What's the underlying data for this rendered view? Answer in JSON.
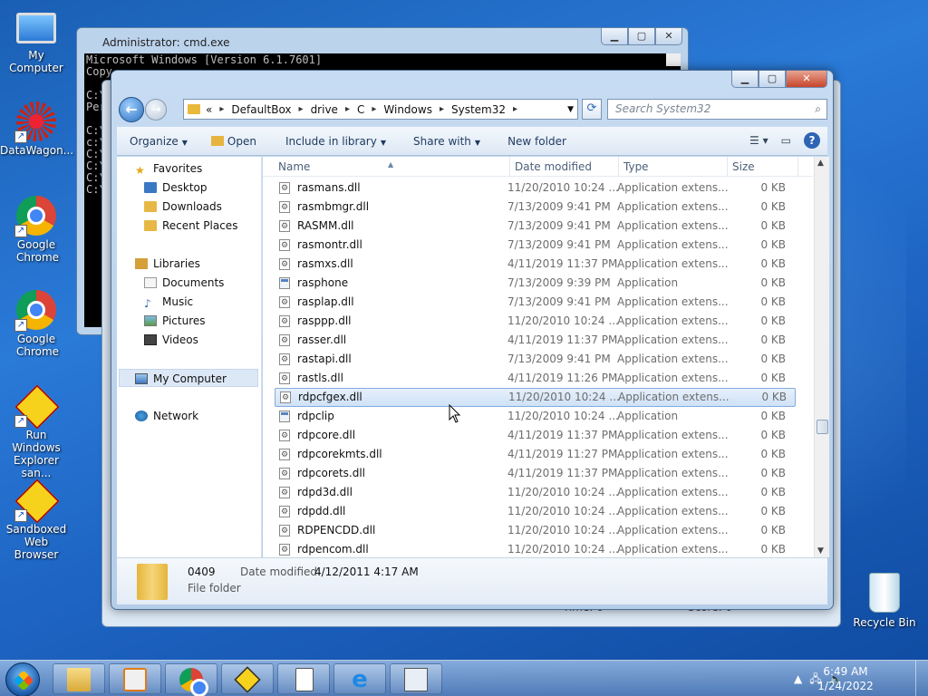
{
  "desktop": {
    "icons": [
      {
        "label": "My Computer"
      },
      {
        "label": "DataWagon..."
      },
      {
        "label": "Google Chrome"
      },
      {
        "label": "Google Chrome"
      },
      {
        "label": "Run Windows Explorer san..."
      },
      {
        "label": "Sandboxed Web Browser"
      },
      {
        "label": "Recycle Bin"
      }
    ]
  },
  "cmd": {
    "title": "Administrator: cmd.exe",
    "lines": [
      "Microsoft Windows [Version 6.1.7601]",
      "Copy",
      "",
      "C:\\W",
      "Perm",
      "",
      "C:\\W",
      "c:\\w",
      "C:\\W",
      "C:\\W",
      "C:\\W",
      "C:\\W"
    ]
  },
  "back_window": {
    "time_label": "Time:  0",
    "score_label": "Score: 0"
  },
  "explorer": {
    "breadcrumb": [
      "«",
      "DefaultBox",
      "drive",
      "C",
      "Windows",
      "System32"
    ],
    "search_placeholder": "Search System32",
    "toolbar": {
      "organize": "Organize",
      "open": "Open",
      "include": "Include in library",
      "share": "Share with",
      "new_folder": "New folder"
    },
    "nav": {
      "favorites": "Favorites",
      "desktop": "Desktop",
      "downloads": "Downloads",
      "recent": "Recent Places",
      "libraries": "Libraries",
      "documents": "Documents",
      "music": "Music",
      "pictures": "Pictures",
      "videos": "Videos",
      "my_computer": "My Computer",
      "network": "Network"
    },
    "columns": {
      "name": "Name",
      "date": "Date modified",
      "type": "Type",
      "size": "Size"
    },
    "files": [
      {
        "name": "rasmans.dll",
        "date": "11/20/2010 10:24 ...",
        "type": "Application extens...",
        "size": "0 KB",
        "kind": "dll"
      },
      {
        "name": "rasmbmgr.dll",
        "date": "7/13/2009 9:41 PM",
        "type": "Application extens...",
        "size": "0 KB",
        "kind": "dll"
      },
      {
        "name": "RASMM.dll",
        "date": "7/13/2009 9:41 PM",
        "type": "Application extens...",
        "size": "0 KB",
        "kind": "dll"
      },
      {
        "name": "rasmontr.dll",
        "date": "7/13/2009 9:41 PM",
        "type": "Application extens...",
        "size": "0 KB",
        "kind": "dll"
      },
      {
        "name": "rasmxs.dll",
        "date": "4/11/2019 11:37 PM",
        "type": "Application extens...",
        "size": "0 KB",
        "kind": "dll"
      },
      {
        "name": "rasphone",
        "date": "7/13/2009 9:39 PM",
        "type": "Application",
        "size": "0 KB",
        "kind": "app"
      },
      {
        "name": "rasplap.dll",
        "date": "7/13/2009 9:41 PM",
        "type": "Application extens...",
        "size": "0 KB",
        "kind": "dll"
      },
      {
        "name": "rasppp.dll",
        "date": "11/20/2010 10:24 ...",
        "type": "Application extens...",
        "size": "0 KB",
        "kind": "dll"
      },
      {
        "name": "rasser.dll",
        "date": "4/11/2019 11:37 PM",
        "type": "Application extens...",
        "size": "0 KB",
        "kind": "dll"
      },
      {
        "name": "rastapi.dll",
        "date": "7/13/2009 9:41 PM",
        "type": "Application extens...",
        "size": "0 KB",
        "kind": "dll"
      },
      {
        "name": "rastls.dll",
        "date": "4/11/2019 11:26 PM",
        "type": "Application extens...",
        "size": "0 KB",
        "kind": "dll"
      },
      {
        "name": "rdpcfgex.dll",
        "date": "11/20/2010 10:24 ...",
        "type": "Application extens...",
        "size": "0 KB",
        "kind": "dll",
        "selected": true
      },
      {
        "name": "rdpclip",
        "date": "11/20/2010 10:24 ...",
        "type": "Application",
        "size": "0 KB",
        "kind": "app"
      },
      {
        "name": "rdpcore.dll",
        "date": "4/11/2019 11:37 PM",
        "type": "Application extens...",
        "size": "0 KB",
        "kind": "dll"
      },
      {
        "name": "rdpcorekmts.dll",
        "date": "4/11/2019 11:27 PM",
        "type": "Application extens...",
        "size": "0 KB",
        "kind": "dll"
      },
      {
        "name": "rdpcorets.dll",
        "date": "4/11/2019 11:37 PM",
        "type": "Application extens...",
        "size": "0 KB",
        "kind": "dll"
      },
      {
        "name": "rdpd3d.dll",
        "date": "11/20/2010 10:24 ...",
        "type": "Application extens...",
        "size": "0 KB",
        "kind": "dll"
      },
      {
        "name": "rdpdd.dll",
        "date": "11/20/2010 10:24 ...",
        "type": "Application extens...",
        "size": "0 KB",
        "kind": "dll"
      },
      {
        "name": "RDPENCDD.dll",
        "date": "11/20/2010 10:24 ...",
        "type": "Application extens...",
        "size": "0 KB",
        "kind": "dll"
      },
      {
        "name": "rdpencom.dll",
        "date": "11/20/2010 10:24 ...",
        "type": "Application extens...",
        "size": "0 KB",
        "kind": "dll"
      }
    ],
    "details": {
      "name": "0409",
      "type": "File folder",
      "modified_label": "Date modified:",
      "modified_value": "4/12/2011 4:17 AM"
    }
  },
  "taskbar": {
    "time": "6:49 AM",
    "date": "1/24/2022",
    "buttons": [
      "explorer-icon",
      "media-player-icon",
      "chrome-icon",
      "sandboxie-icon",
      "solitaire-icon",
      "ie-icon",
      "cmd-icon"
    ]
  }
}
